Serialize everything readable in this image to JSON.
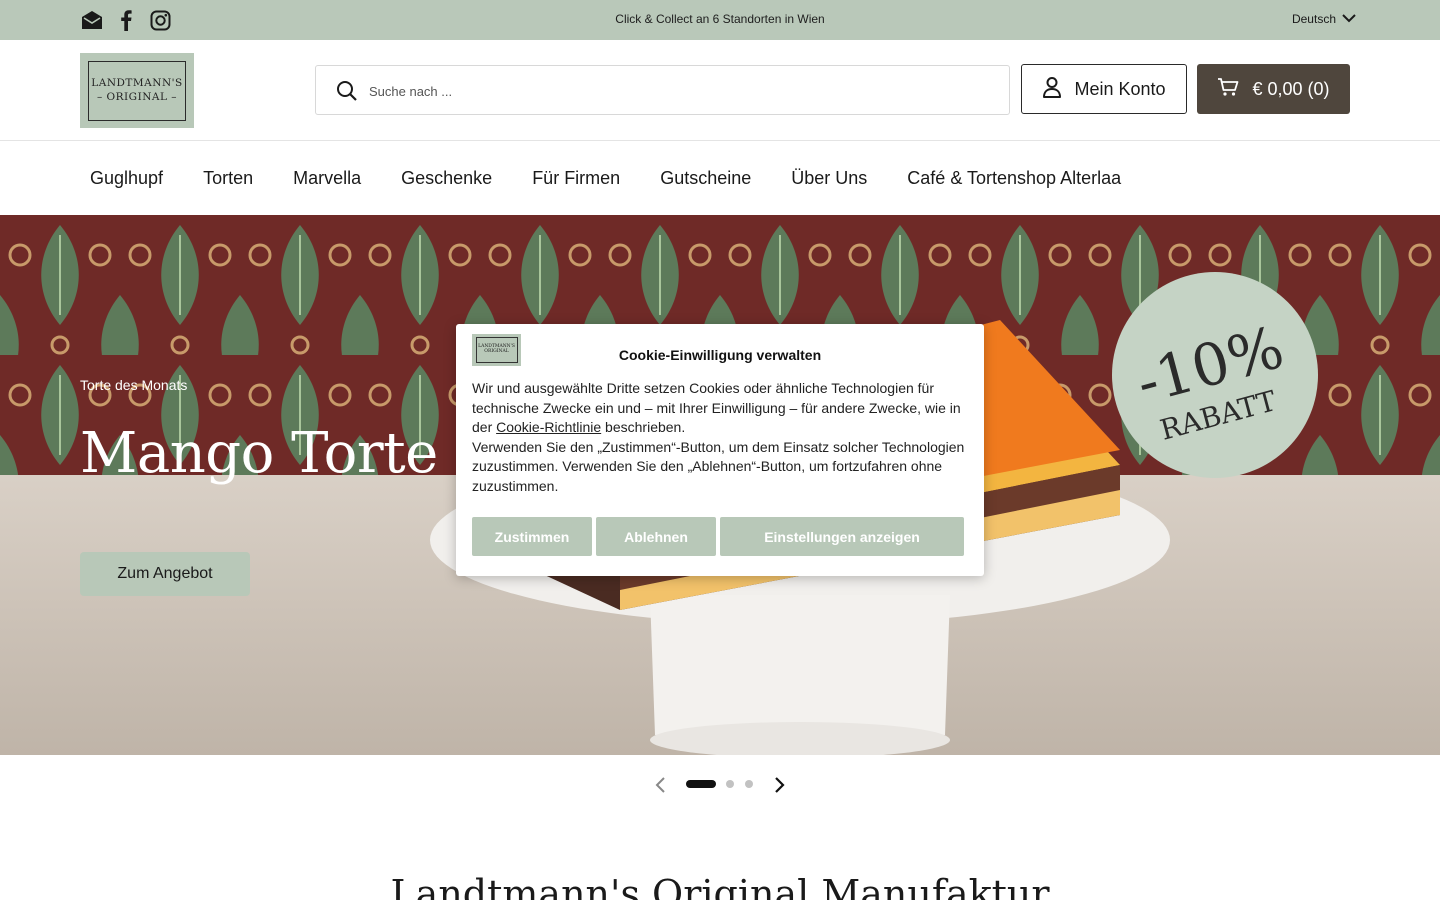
{
  "topbar": {
    "promo": "Click & Collect an 6 Standorten in Wien",
    "language": "Deutsch",
    "social_icons": [
      "email-icon",
      "facebook-icon",
      "instagram-icon"
    ],
    "background": "#b9c8b9"
  },
  "header": {
    "logo_line1": "LANDTMANN'S",
    "logo_line2": "– ORIGINAL –",
    "search_placeholder": "Suche nach ...",
    "account_label": "Mein Konto",
    "cart_label": "€ 0,00 (0)",
    "cart_background": "#4f463d"
  },
  "nav": {
    "items": [
      "Guglhupf",
      "Torten",
      "Marvella",
      "Geschenke",
      "Für Firmen",
      "Gutscheine",
      "Über Uns",
      "Café & Tortenshop Alterlaa"
    ]
  },
  "hero": {
    "eyebrow": "Torte des Monats",
    "title": "Mango Torte",
    "cta": "Zum Angebot",
    "badge_line1": "-10%",
    "badge_line2": "RABATT",
    "slides_total": 3,
    "active_slide": 1
  },
  "section": {
    "title": "Landtmann's Original Manufaktur"
  },
  "cookie": {
    "title": "Cookie-Einwilligung verwalten",
    "text_before_link": "Wir und ausgewählte Dritte setzen Cookies oder ähnliche Technologien für technische Zwecke ein und – mit Ihrer Einwilligung – für andere Zwecke, wie in der ",
    "link": "Cookie-Richtlinie",
    "text_after_link": " beschrieben.",
    "text_second": "Verwenden Sie den „Zustimmen“-Button, um dem Einsatz solcher Technologien zuzustimmen. Verwenden Sie den „Ablehnen“-Button, um fortzufahren ohne zuzustimmen.",
    "accept": "Zustimmen",
    "reject": "Ablehnen",
    "settings": "Einstellungen anzeigen",
    "logo_text": "LANDTMANN'S ORIGINAL",
    "accent": "#b8c8b8"
  }
}
